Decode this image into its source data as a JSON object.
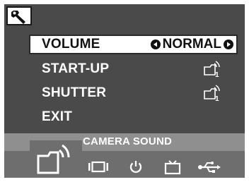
{
  "menu": {
    "items": [
      {
        "label": "VOLUME",
        "value": "NORMAL",
        "selected": true
      },
      {
        "label": "START-UP",
        "icon": "sound-1-icon"
      },
      {
        "label": "SHUTTER",
        "icon": "sound-1-icon"
      },
      {
        "label": "EXIT"
      }
    ]
  },
  "header": {
    "icon": "wrench-icon"
  },
  "bottom": {
    "label": "CAMERA SOUND",
    "categories": [
      {
        "name": "camera-sound",
        "icon": "camera-sound-icon",
        "selected": true
      },
      {
        "name": "display",
        "icon": "display-icon"
      },
      {
        "name": "power",
        "icon": "power-icon"
      },
      {
        "name": "tv",
        "icon": "tv-icon"
      },
      {
        "name": "usb",
        "icon": "usb-icon"
      }
    ]
  },
  "colors": {
    "panel": "#4a4a4a",
    "bottom_bar": "#6e6e6e",
    "label_strip": "#8f8f8f",
    "highlight": "#ffffff",
    "text": "#ffffff"
  }
}
